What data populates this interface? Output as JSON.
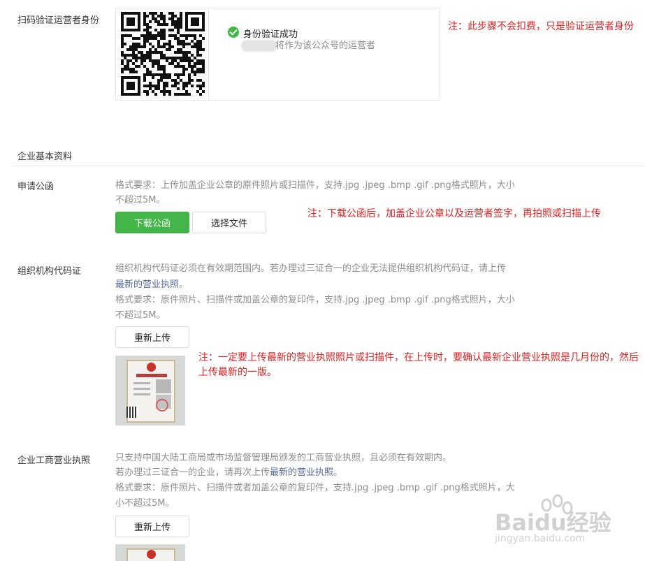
{
  "operator_verify": {
    "label": "扫码验证运营者身份",
    "status": "身份验证成功",
    "status_detail": "将作为该公众号的运营者",
    "note": "注：此步骤不会扣费，只是验证运营者身份"
  },
  "section": {
    "title": "企业基本资料"
  },
  "application_letter": {
    "label": "申请公函",
    "requirement_line1": "格式要求：上传加盖企业公章的原件照片或扫描件，支持.jpg .jpeg .bmp .gif .png格式照片，大小",
    "requirement_line2": "不超过5M。",
    "download_button": "下载公函",
    "choose_file_button": "选择文件",
    "note": "注：下载公函后，加盖企业公章以及运营者签字，再拍照或扫描上传"
  },
  "org_code": {
    "label": "组织机构代码证",
    "desc_line1": "组织机构代码证必须在有效期范围内。若办理过三证合一的企业无法提供组织机构代码证，请上传",
    "desc_link": "最新的营业执照",
    "desc_end": "。",
    "requirement_line1": "格式要求：原件照片、扫描件或加盖公章的复印件，支持.jpg .jpeg .bmp .gif .png格式照片，大小",
    "requirement_line2": "不超过5M。",
    "reupload_button": "重新上传",
    "note": "注：一定要上传最新的营业执照照片或扫描件，在上传时，要确认最新企业营业执照是几月份的，然后上传最新的一版。"
  },
  "business_license": {
    "label": "企业工商营业执照",
    "desc_line1": "只支持中国大陆工商局或市场监督管理局颁发的工商营业执照，且必须在有效期内。",
    "desc_line2_prefix": "若办理过三证合一的企业，请再次上传",
    "desc_link": "最新的营业执照",
    "desc_end": "。",
    "requirement_line1": "格式要求：原件照片、扫描件或者加盖公章的复印件，支持.jpg .jpeg .bmp .gif .png格式照片，大",
    "requirement_line2": "小不超过5M。",
    "reupload_button": "重新上传"
  },
  "watermark": {
    "brand": "Baidu经验",
    "url": "jingyan.baidu.com"
  },
  "colors": {
    "accent_green": "#44b549",
    "note_red": "#e02020",
    "link_blue": "#576b95"
  }
}
